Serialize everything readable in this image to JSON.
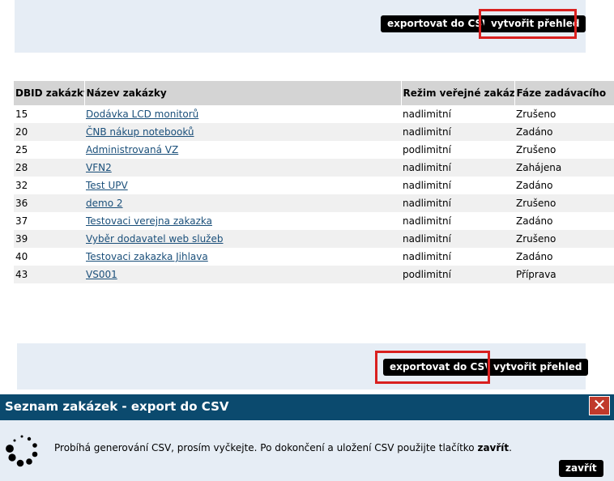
{
  "top_toolbar": {
    "export_label": "exportovat do CSV",
    "overview_label": "vytvořit přehled"
  },
  "bottom_toolbar": {
    "export_label": "exportovat do CSV",
    "overview_label": "vytvořit přehled"
  },
  "table": {
    "headers": [
      "DBID zakázky",
      "Název zakázky",
      "Režim veřejné zakázky",
      "Fáze zadávacího"
    ],
    "rows": [
      [
        "15",
        "Dodávka LCD monitorů",
        "nadlimitní",
        "Zrušeno"
      ],
      [
        "20",
        "ČNB nákup notebooků",
        "nadlimitní",
        "Zadáno"
      ],
      [
        "25",
        "Administrovaná VZ",
        "podlimitní",
        "Zrušeno"
      ],
      [
        "28",
        "VFN2",
        "nadlimitní",
        "Zahájena"
      ],
      [
        "32",
        "Test UPV",
        "nadlimitní",
        "Zadáno"
      ],
      [
        "36",
        "demo 2",
        "nadlimitní",
        "Zrušeno"
      ],
      [
        "37",
        "Testovaci verejna zakazka",
        "nadlimitní",
        "Zadáno"
      ],
      [
        "39",
        "Vyběr dodavatel web služeb",
        "nadlimitní",
        "Zrušeno"
      ],
      [
        "40",
        "Testovaci zakazka Jihlava",
        "nadlimitní",
        "Zadáno"
      ],
      [
        "43",
        "VS001",
        "podlimitní",
        "Příprava"
      ]
    ]
  },
  "dialog": {
    "title": "Seznam zakázek - export do CSV",
    "close_icon": "close-icon",
    "message_before": "Probíhá generování CSV, prosím vyčkejte. Po dokončení a uložení CSV použijte tlačítko ",
    "message_bold": "zavřít",
    "message_after": ".",
    "close_button_label": "zavřít",
    "spinner_icon": "loading-spinner-icon",
    "accent_color": "#0b4a6e",
    "close_color": "#c0392b",
    "highlight_color": "#d9201f"
  }
}
